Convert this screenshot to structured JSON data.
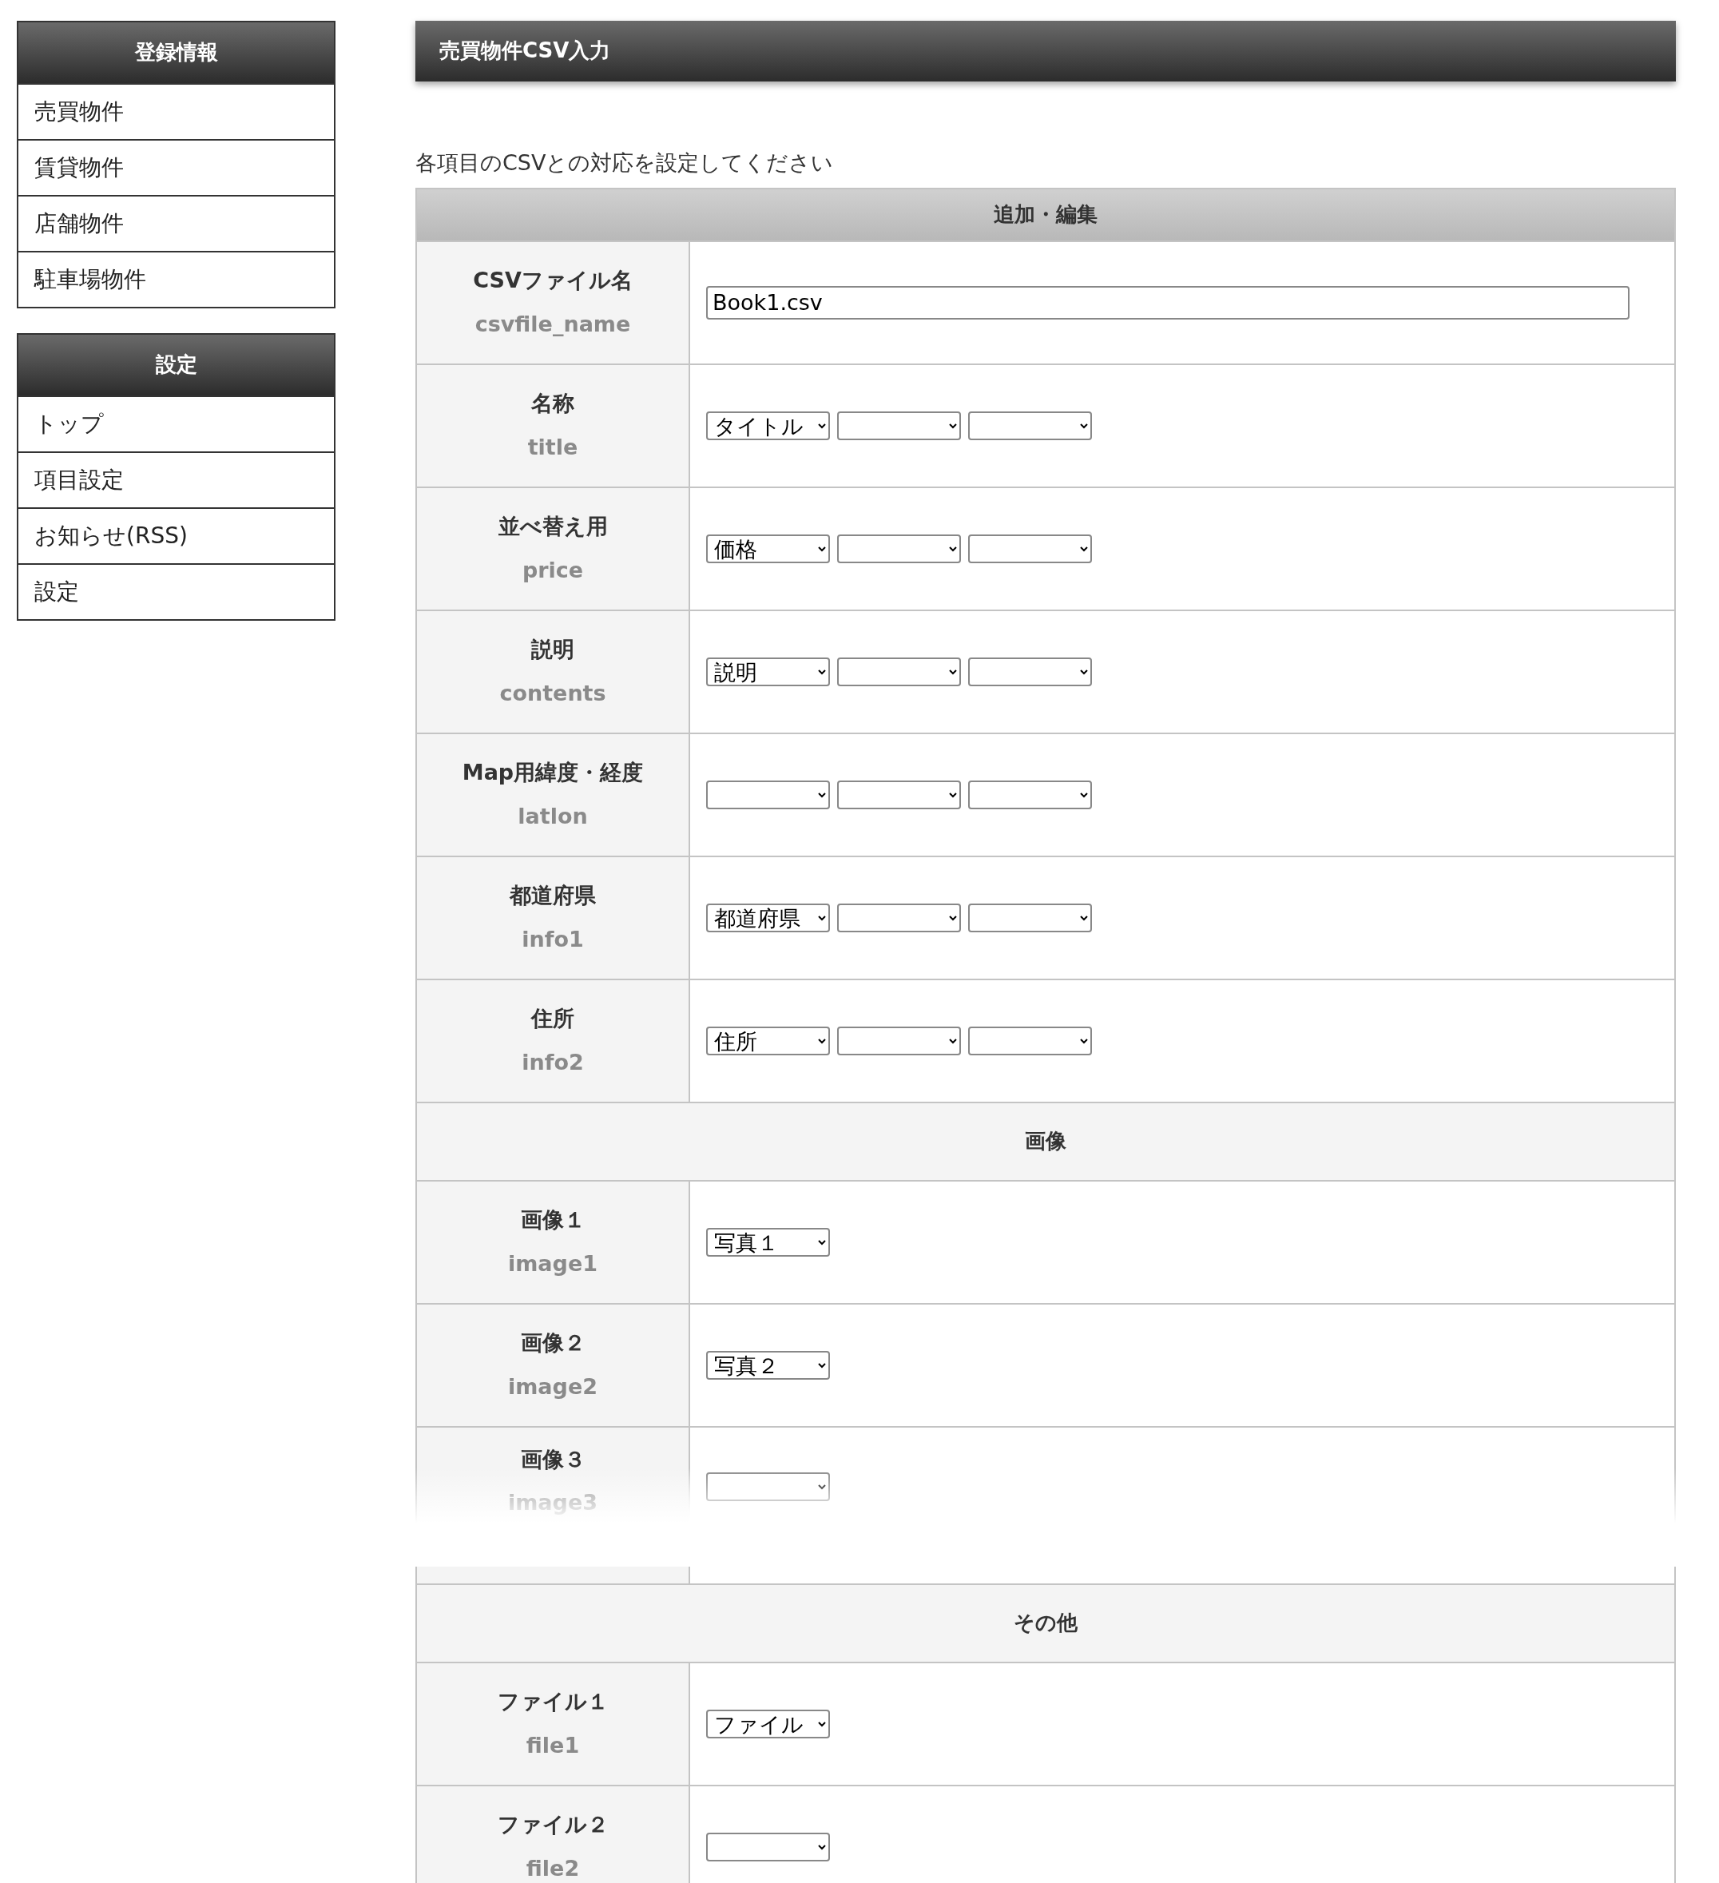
{
  "sidebar": [
    {
      "title": "登録情報",
      "items": [
        "売買物件",
        "賃貸物件",
        "店舗物件",
        "駐車場物件"
      ]
    },
    {
      "title": "設定",
      "items": [
        "トップ",
        "項目設定",
        "お知らせ(RSS)",
        "設定"
      ]
    }
  ],
  "page_title": "売買物件CSV入力",
  "instruction": "各項目のCSVとの対応を設定してください",
  "table": {
    "header": "追加・編集",
    "rows": [
      {
        "kind": "text",
        "label": "CSVファイル名",
        "key": "csvfile_name",
        "value": "Book1.csv"
      },
      {
        "kind": "selects",
        "label": "名称",
        "key": "title",
        "selects": [
          {
            "kind": "chosen",
            "value": "タイトル"
          },
          {
            "kind": "blank"
          },
          {
            "kind": "blank"
          }
        ]
      },
      {
        "kind": "selects",
        "label": "並べ替え用",
        "key": "price",
        "selects": [
          {
            "kind": "chosen",
            "value": "価格"
          },
          {
            "kind": "blank"
          },
          {
            "kind": "blank"
          }
        ]
      },
      {
        "kind": "selects",
        "label": "説明",
        "key": "contents",
        "selects": [
          {
            "kind": "chosen",
            "value": "説明"
          },
          {
            "kind": "blank"
          },
          {
            "kind": "blank"
          }
        ]
      },
      {
        "kind": "selects",
        "label": "Map用緯度・経度",
        "key": "latlon",
        "selects": [
          {
            "kind": "blank"
          },
          {
            "kind": "blank"
          },
          {
            "kind": "blank"
          }
        ]
      },
      {
        "kind": "selects",
        "label": "都道府県",
        "key": "info1",
        "selects": [
          {
            "kind": "chosen",
            "value": "都道府県"
          },
          {
            "kind": "blank"
          },
          {
            "kind": "blank"
          }
        ]
      },
      {
        "kind": "selects",
        "label": "住所",
        "key": "info2",
        "selects": [
          {
            "kind": "chosen",
            "value": "住所"
          },
          {
            "kind": "blank"
          },
          {
            "kind": "blank"
          }
        ]
      },
      {
        "kind": "section",
        "label": "画像"
      },
      {
        "kind": "selects",
        "label": "画像１",
        "key": "image1",
        "selects": [
          {
            "kind": "chosen",
            "value": "写真１"
          }
        ]
      },
      {
        "kind": "selects",
        "label": "画像２",
        "key": "image2",
        "selects": [
          {
            "kind": "chosen",
            "value": "写真２"
          }
        ]
      },
      {
        "kind": "selects",
        "label": "画像３",
        "key": "image3",
        "faded": true,
        "selects": [
          {
            "kind": "blank"
          }
        ]
      },
      {
        "kind": "section",
        "label": "その他"
      },
      {
        "kind": "selects",
        "label": "ファイル１",
        "key": "file1",
        "selects": [
          {
            "kind": "chosen",
            "value": "ファイル"
          }
        ]
      },
      {
        "kind": "selects",
        "label": "ファイル２",
        "key": "file2",
        "selects": [
          {
            "kind": "blank"
          }
        ]
      }
    ]
  }
}
